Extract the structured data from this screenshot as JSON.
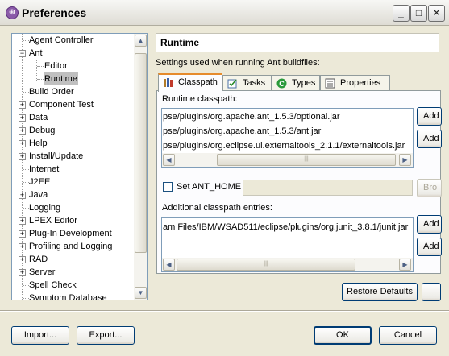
{
  "window": {
    "title": "Preferences",
    "min": "_",
    "max": "□",
    "close": "✕"
  },
  "tree": {
    "items": [
      {
        "label": "Agent Controller"
      },
      {
        "label": "Ant"
      },
      {
        "label": "Editor"
      },
      {
        "label": "Runtime"
      },
      {
        "label": "Build Order"
      },
      {
        "label": "Component Test"
      },
      {
        "label": "Data"
      },
      {
        "label": "Debug"
      },
      {
        "label": "Help"
      },
      {
        "label": "Install/Update"
      },
      {
        "label": "Internet"
      },
      {
        "label": "J2EE"
      },
      {
        "label": "Java"
      },
      {
        "label": "Logging"
      },
      {
        "label": "LPEX Editor"
      },
      {
        "label": "Plug-In Development"
      },
      {
        "label": "Profiling and Logging"
      },
      {
        "label": "RAD"
      },
      {
        "label": "Server"
      },
      {
        "label": "Spell Check"
      },
      {
        "label": "Symptom Database"
      }
    ],
    "expand_plus": "+",
    "expand_minus": "−"
  },
  "page": {
    "title": "Runtime",
    "description": "Settings used when running Ant buildfiles:"
  },
  "tabs": [
    {
      "label": "Classpath"
    },
    {
      "label": "Tasks"
    },
    {
      "label": "Types"
    },
    {
      "label": "Properties"
    }
  ],
  "classpath": {
    "runtime_label": "Runtime classpath:",
    "runtime_entries": [
      "pse/plugins/org.apache.ant_1.5.3/optional.jar",
      "pse/plugins/org.apache.ant_1.5.3/ant.jar",
      "pse/plugins/org.eclipse.ui.externaltools_2.1.1/externaltools.jar"
    ],
    "add1": "Add",
    "add2": "Add",
    "ant_home_label": "Set ANT_HOME",
    "browse": "Bro",
    "additional_label": "Additional classpath entries:",
    "additional_entries": [
      "am Files/IBM/WSAD511/eclipse/plugins/org.junit_3.8.1/junit.jar"
    ],
    "add3": "Add",
    "add4": "Add"
  },
  "buttons": {
    "restore": "Restore Defaults",
    "import": "Import...",
    "export": "Export...",
    "ok": "OK",
    "cancel": "Cancel"
  },
  "scroll": {
    "up": "▲",
    "down": "▼",
    "left": "◀",
    "right": "▶",
    "grip": "|||"
  }
}
